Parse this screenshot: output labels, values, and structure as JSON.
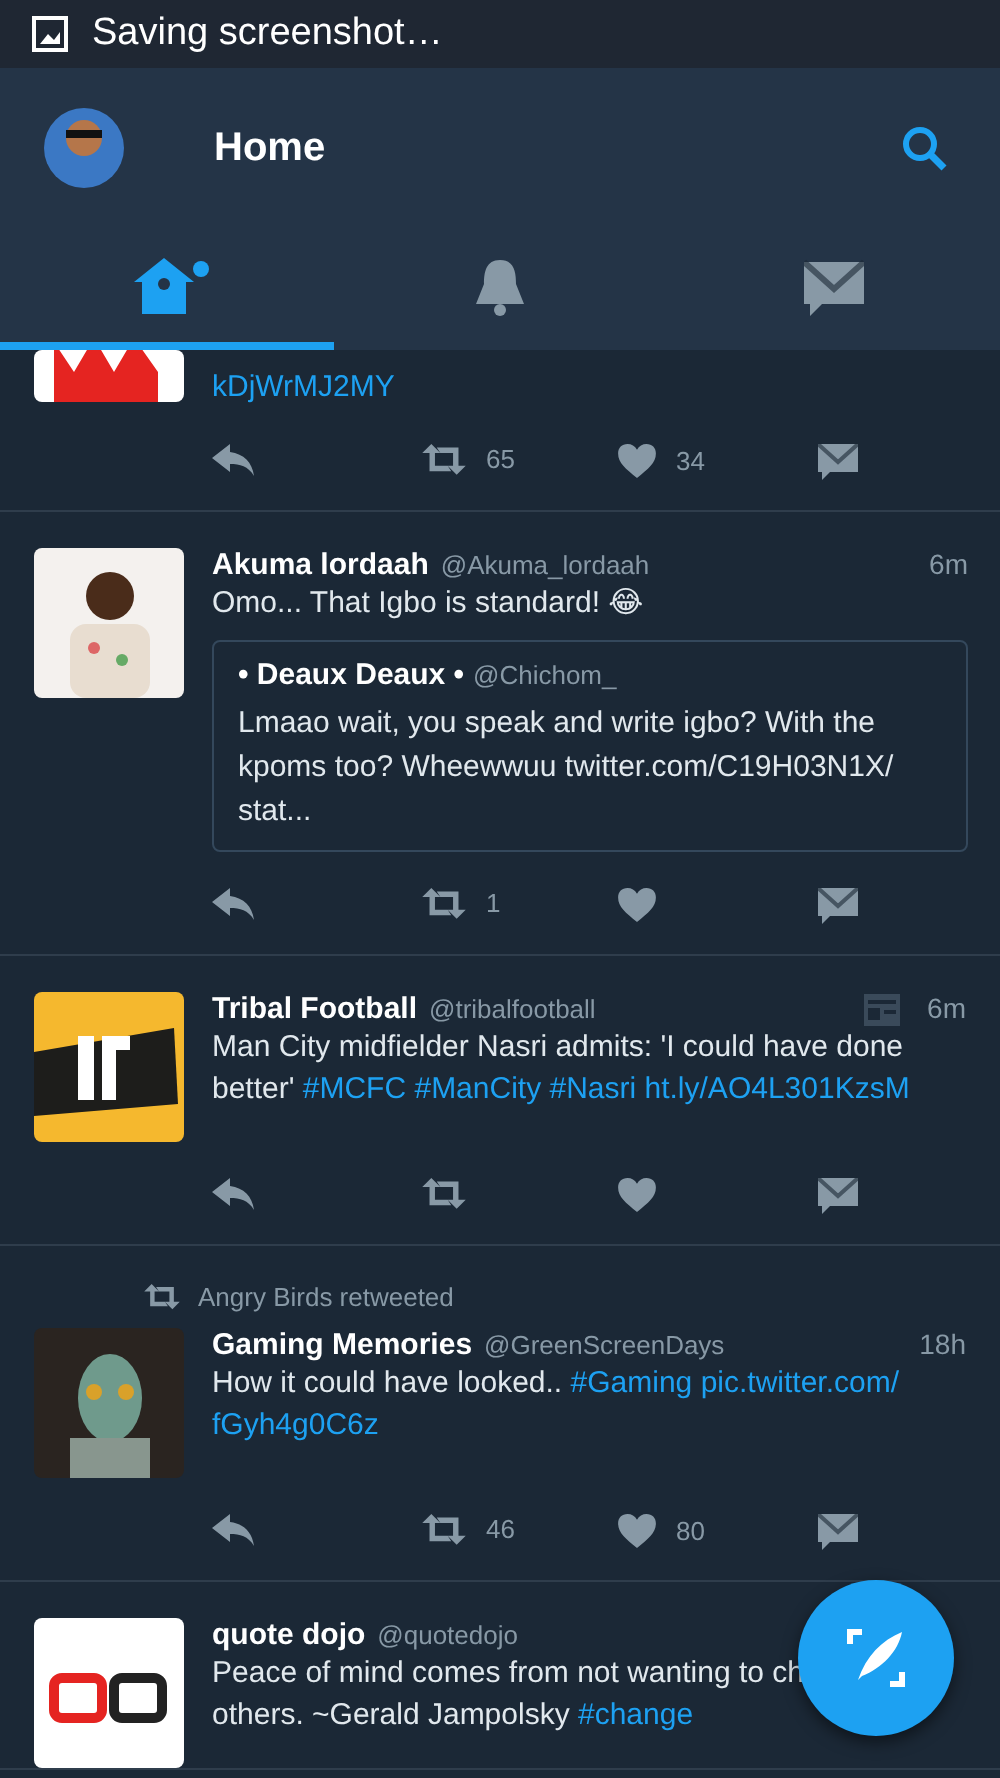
{
  "status_bar": {
    "text": "Saving screenshot…"
  },
  "header": {
    "title": "Home"
  },
  "tabs": [
    {
      "selected": true,
      "unread": true
    },
    {
      "selected": false,
      "unread": false
    },
    {
      "selected": false,
      "unread": false
    }
  ],
  "tweets": [
    {
      "partial": true,
      "lines": [
        [
          {
            "kind": "link",
            "text": "kDjWrMJ2MY"
          }
        ]
      ],
      "retweets": "65",
      "likes": "34"
    },
    {
      "partial": false,
      "name": "Akuma lordaah",
      "handle": "@Akuma_lordaah",
      "time": "6m",
      "lines": [
        [
          {
            "kind": "text",
            "text": "Omo...  That Igbo is standard! 😂"
          }
        ]
      ],
      "quote": {
        "name": "• Deaux Deaux •",
        "handle": "@Chichom_",
        "text": "Lmaao wait, you speak and write igbo? With the kpoms too? Wheewwuu twitter.com/C19H03N1X/ stat..."
      },
      "retweets": "1"
    },
    {
      "partial": false,
      "name": "Tribal Football",
      "handle": "@tribalfootball",
      "time": "6m",
      "has_card": true,
      "lines": [
        [
          {
            "kind": "text",
            "text": "Man City midfielder Nasri admits: 'I could have done"
          }
        ],
        [
          {
            "kind": "text",
            "text": "better' "
          },
          {
            "kind": "link",
            "text": "#MCFC #ManCity #Nasri ht.ly/AO4L301KzsM"
          }
        ]
      ]
    },
    {
      "partial": false,
      "retweeted_by": "Angry Birds retweeted",
      "name": "Gaming Memories",
      "handle": "@GreenScreenDays",
      "time": "18h",
      "lines": [
        [
          {
            "kind": "text",
            "text": "How it could have looked.. "
          },
          {
            "kind": "link",
            "text": "#Gaming pic.twitter.com/"
          }
        ],
        [
          {
            "kind": "link",
            "text": "fGyh4g0C6z"
          }
        ]
      ],
      "retweets": "46",
      "likes": "80"
    },
    {
      "partial": false,
      "name": "quote dojo",
      "handle": "@quotedojo",
      "lines": [
        [
          {
            "kind": "text",
            "text": "Peace of mind comes from not wanting to ch"
          }
        ],
        [
          {
            "kind": "text",
            "text": "others. ~Gerald Jampolsky "
          },
          {
            "kind": "link",
            "text": "#change"
          }
        ]
      ]
    }
  ]
}
